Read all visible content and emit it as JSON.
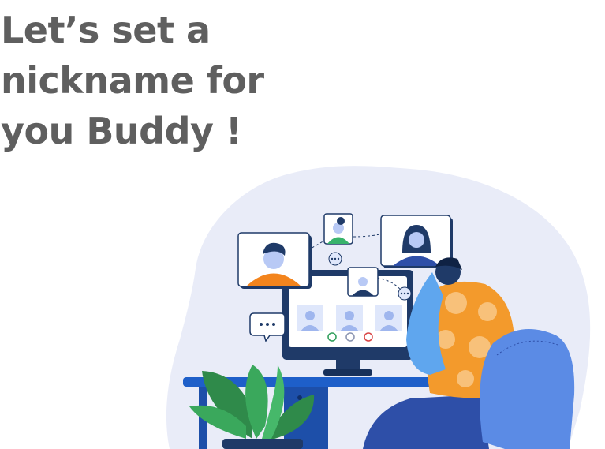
{
  "headline": {
    "line1": "Let’s set a",
    "line2": "nickname for",
    "line3": "you Buddy !"
  },
  "illustration": {
    "subject": "video-call-illustration",
    "colors": {
      "blob": "#e9ecf8",
      "monitor": "#1f3a68",
      "desk": "#1e5fc9",
      "accent_orange": "#f39a2c",
      "chair": "#5b8be5",
      "plant": "#2f8a4a",
      "skin": "#b8c9f5"
    }
  }
}
